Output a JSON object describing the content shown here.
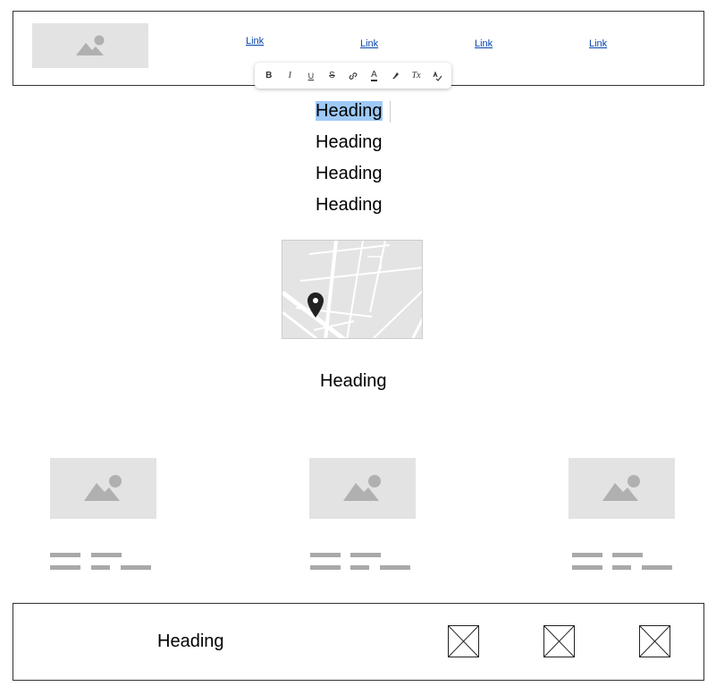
{
  "header": {
    "links": [
      "Link",
      "Link",
      "Link",
      "Link"
    ]
  },
  "toolbar": {
    "buttons": [
      {
        "name": "bold-button",
        "label": "B",
        "icon": "bold-icon"
      },
      {
        "name": "italic-button",
        "label": "I",
        "icon": "italic-icon"
      },
      {
        "name": "underline-button",
        "label": "U",
        "icon": "underline-icon"
      },
      {
        "name": "strikethrough-button",
        "label": "S",
        "icon": "strikethrough-icon"
      },
      {
        "name": "link-button",
        "label": "",
        "icon": "link-icon"
      },
      {
        "name": "text-color-button",
        "label": "A",
        "icon": "text-color-icon"
      },
      {
        "name": "highlight-button",
        "label": "",
        "icon": "highlighter-icon"
      },
      {
        "name": "clear-format-button",
        "label": "Tx",
        "icon": "clear-format-icon"
      },
      {
        "name": "spellcheck-button",
        "label": "",
        "icon": "spellcheck-icon"
      }
    ]
  },
  "headings": [
    "Heading",
    "Heading",
    "Heading",
    "Heading"
  ],
  "map": {
    "icon": "map-pin-icon"
  },
  "section_heading": "Heading",
  "footer": {
    "heading": "Heading"
  },
  "colors": {
    "placeholder": "#e3e3e3",
    "selection": "#9ec9f7",
    "link": "#0645ad"
  }
}
